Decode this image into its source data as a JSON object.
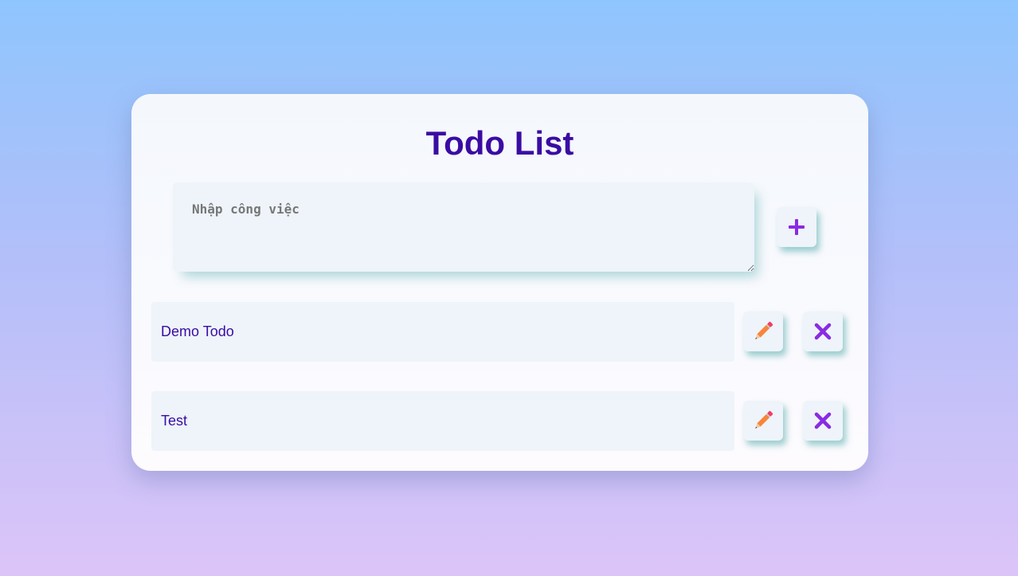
{
  "app": {
    "title": "Todo List"
  },
  "input": {
    "placeholder": "Nhập công việc",
    "value": ""
  },
  "add_button": {
    "icon": "plus-icon",
    "color": "#8a2be2"
  },
  "todos": [
    {
      "text": "Demo Todo",
      "edit_icon": "pencil-icon",
      "delete_icon": "close-icon"
    },
    {
      "text": "Test",
      "edit_icon": "pencil-icon",
      "delete_icon": "close-icon"
    }
  ],
  "colors": {
    "title": "#3a0ca3",
    "todo_text": "#3a0ca3",
    "accent": "#8a2be2",
    "pencil_body": "#f7853b",
    "pencil_eraser": "#ef3e63"
  }
}
